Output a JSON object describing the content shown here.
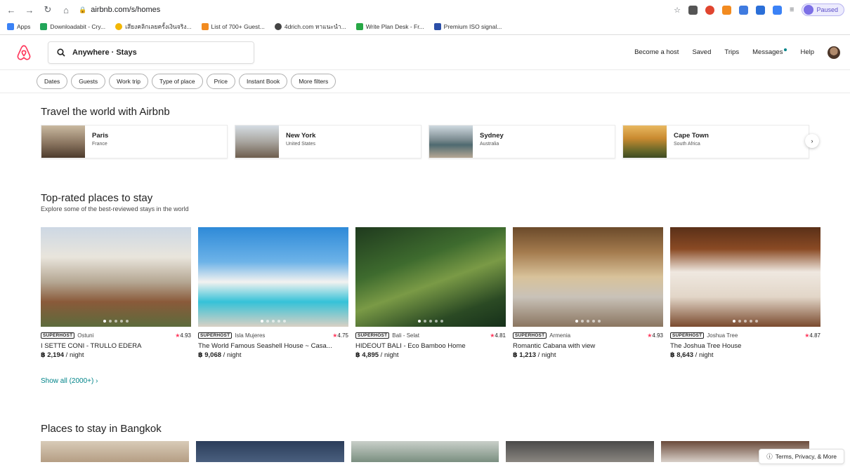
{
  "browser": {
    "url": "airbnb.com/s/homes",
    "profile_status": "Paused",
    "bookmarks": [
      {
        "label": "Apps",
        "color": "#3b82f6"
      },
      {
        "label": "Downloadabit - Cry...",
        "color": "#22a559"
      },
      {
        "label": "เสียงคลิกเลยครั้งเงินจริง...",
        "color": "#f2b705"
      },
      {
        "label": "List of 700+ Guest...",
        "color": "#f28b20"
      },
      {
        "label": "4drich.com หาแนะนำ...",
        "color": "#444444"
      },
      {
        "label": "Write Plan Desk - Fr...",
        "color": "#27a845"
      },
      {
        "label": "Premium ISO signal...",
        "color": "#2b4fa8"
      }
    ]
  },
  "header": {
    "search_text": "Anywhere · Stays",
    "nav": [
      "Become a host",
      "Saved",
      "Trips",
      "Messages",
      "Help"
    ]
  },
  "filters": [
    "Dates",
    "Guests",
    "Work trip",
    "Type of place",
    "Price",
    "Instant Book",
    "More filters"
  ],
  "travel": {
    "title": "Travel the world with Airbnb",
    "destinations": [
      {
        "name": "Paris",
        "country": "France"
      },
      {
        "name": "New York",
        "country": "United States"
      },
      {
        "name": "Sydney",
        "country": "Australia"
      },
      {
        "name": "Cape Town",
        "country": "South Africa"
      }
    ]
  },
  "top_rated": {
    "title": "Top-rated places to stay",
    "subtitle": "Explore some of the best-reviewed stays in the world",
    "badge": "SUPERHOST",
    "listings": [
      {
        "location": "Ostuni",
        "rating": "4.93",
        "name": "I SETTE CONI - TRULLO EDERA",
        "price": "฿ 2,194",
        "unit": " / night"
      },
      {
        "location": "Isla Mujeres",
        "rating": "4.75",
        "name": "The World Famous Seashell House ~ Casa...",
        "price": "฿ 9,068",
        "unit": " / night"
      },
      {
        "location": "Bali - Selat",
        "rating": "4.81",
        "name": "HIDEOUT BALI - Eco Bamboo Home",
        "price": "฿ 4,895",
        "unit": " / night"
      },
      {
        "location": "Armenia",
        "rating": "4.93",
        "name": "Romantic Cabana with view",
        "price": "฿ 1,213",
        "unit": " / night"
      },
      {
        "location": "Joshua Tree",
        "rating": "4.87",
        "name": "The Joshua Tree House",
        "price": "฿ 8,643",
        "unit": " / night"
      }
    ],
    "show_all": "Show all (2000+) ›"
  },
  "bangkok": {
    "title": "Places to stay in Bangkok"
  },
  "footer": {
    "terms": "Terms, Privacy, & More"
  }
}
